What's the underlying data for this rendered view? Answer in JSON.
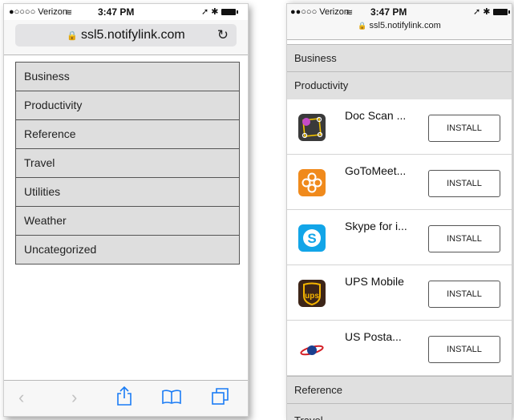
{
  "left": {
    "status": {
      "carrier": "●○○○○ Verizon",
      "time": "3:47 PM"
    },
    "url": "ssl5.notifylink.com",
    "categories": [
      "Business",
      "Productivity",
      "Reference",
      "Travel",
      "Utilities",
      "Weather",
      "Uncategorized"
    ],
    "toolbar_icons": [
      "back-icon",
      "forward-icon",
      "share-icon",
      "bookmarks-icon",
      "tabs-icon"
    ]
  },
  "right": {
    "status": {
      "carrier": "●●○○○ Verizon",
      "time": "3:47 PM"
    },
    "url": "ssl5.notifylink.com",
    "sections_top": [
      "Business",
      "Productivity"
    ],
    "apps": [
      {
        "name": "Doc Scan ...",
        "button": "INSTALL",
        "icon": "doc-scan-icon"
      },
      {
        "name": "GoToMeet...",
        "button": "INSTALL",
        "icon": "gotomeeting-icon"
      },
      {
        "name": "Skype for i...",
        "button": "INSTALL",
        "icon": "skype-icon"
      },
      {
        "name": "UPS Mobile",
        "button": "INSTALL",
        "icon": "ups-icon"
      },
      {
        "name": "US Posta...",
        "button": "INSTALL",
        "icon": "usps-icon"
      }
    ],
    "sections_bottom": [
      "Reference",
      "Travel"
    ]
  }
}
